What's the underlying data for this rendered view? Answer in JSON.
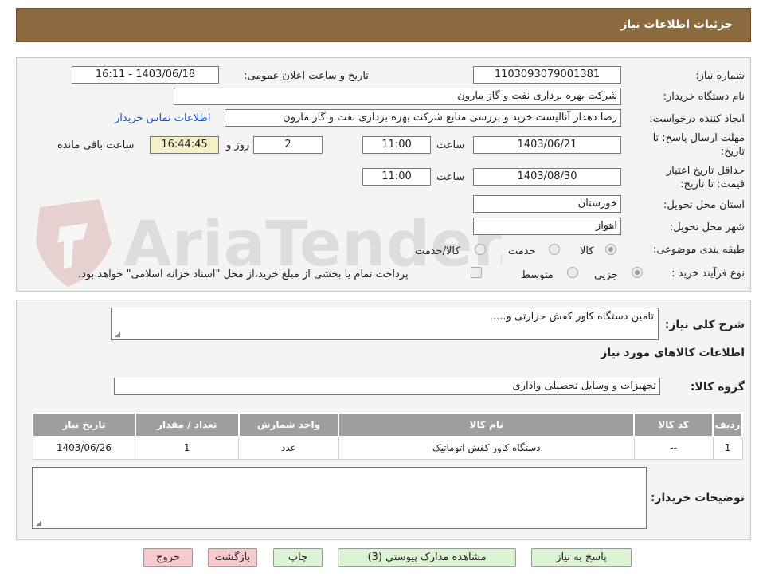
{
  "header": {
    "title": "جزئیات اطلاعات نیاز"
  },
  "watermark": {
    "text": "AriaTender.neT"
  },
  "form": {
    "need_number": {
      "label": "شماره نیاز:",
      "value": "1103093079001381"
    },
    "announce": {
      "label": "تاریخ و ساعت اعلان عمومی:",
      "value": "1403/06/18 - 16:11"
    },
    "buyer_org": {
      "label": "نام دستگاه خریدار:",
      "value": "شرکت بهره برداری نفت و گاز مارون"
    },
    "requester": {
      "label": "ایجاد کننده درخواست:",
      "value": "رضا دهدار آنالیست خرید و بررسی منابع شرکت بهره برداری نفت و گاز مارون"
    },
    "contact_link": "اطلاعات تماس خریدار",
    "reply_deadline": {
      "label_line1": "مهلت ارسال پاسخ: تا",
      "label_line2": "تاریخ:",
      "date": "1403/06/21",
      "time_label": "ساعت",
      "time": "11:00",
      "days": "2",
      "days_label": "روز و",
      "remaining": "16:44:45",
      "remaining_label": "ساعت باقی مانده"
    },
    "price_validity": {
      "label_line1": "حداقل تاریخ اعتبار",
      "label_line2": "قیمت: تا تاریخ:",
      "date": "1403/08/30",
      "time_label": "ساعت",
      "time": "11:00"
    },
    "province": {
      "label": "استان محل تحویل:",
      "value": "خوزستان"
    },
    "city": {
      "label": "شهر محل تحویل:",
      "value": "اهواز"
    },
    "category": {
      "label": "طبقه بندی موضوعی:",
      "options": [
        "کالا",
        "خدمت",
        "کالا/خدمت"
      ],
      "selected": "کالا"
    },
    "process": {
      "label": "نوع فرآیند خرید :",
      "options": [
        "جزیی",
        "متوسط"
      ],
      "selected": "جزیی",
      "payment_note": "پرداخت تمام یا بخشی از مبلغ خرید،از محل \"اسناد خزانه اسلامی\" خواهد بود."
    }
  },
  "details": {
    "summary_label": "شرح کلی نیاز:",
    "summary_value": "تامین دستگاه کاور کفش حرارتی و.....",
    "goods_info_title": "اطلاعات کالاهای مورد نیاز",
    "group_label": "گروه کالا:",
    "group_value": "تجهیزات و وسایل تحصیلی واداری",
    "table": {
      "headers": [
        "ردیف",
        "کد کالا",
        "نام کالا",
        "واحد شمارش",
        "تعداد / مقدار",
        "تاریخ نیاز"
      ],
      "rows": [
        [
          "1",
          "--",
          "دستگاه کاور کفش اتوماتیک",
          "عدد",
          "1",
          "1403/06/26"
        ]
      ]
    },
    "buyer_notes_label": "توضیحات خریدار:",
    "buyer_notes_value": ""
  },
  "buttons": {
    "reply": "پاسخ به نیاز",
    "attachments": "مشاهده مدارک پیوستي (3)",
    "print": "چاپ",
    "back": "بازگشت",
    "exit": "خروج"
  },
  "colors": {
    "header_bg": "#8b6a3e",
    "panel_bg": "#f4f4f4",
    "table_header_bg": "#9e9e9e",
    "button_green": "#dcf2d4",
    "button_pink": "#f7c9cd",
    "countdown_bg": "#f5f0c8",
    "link": "#1a4fd0"
  }
}
